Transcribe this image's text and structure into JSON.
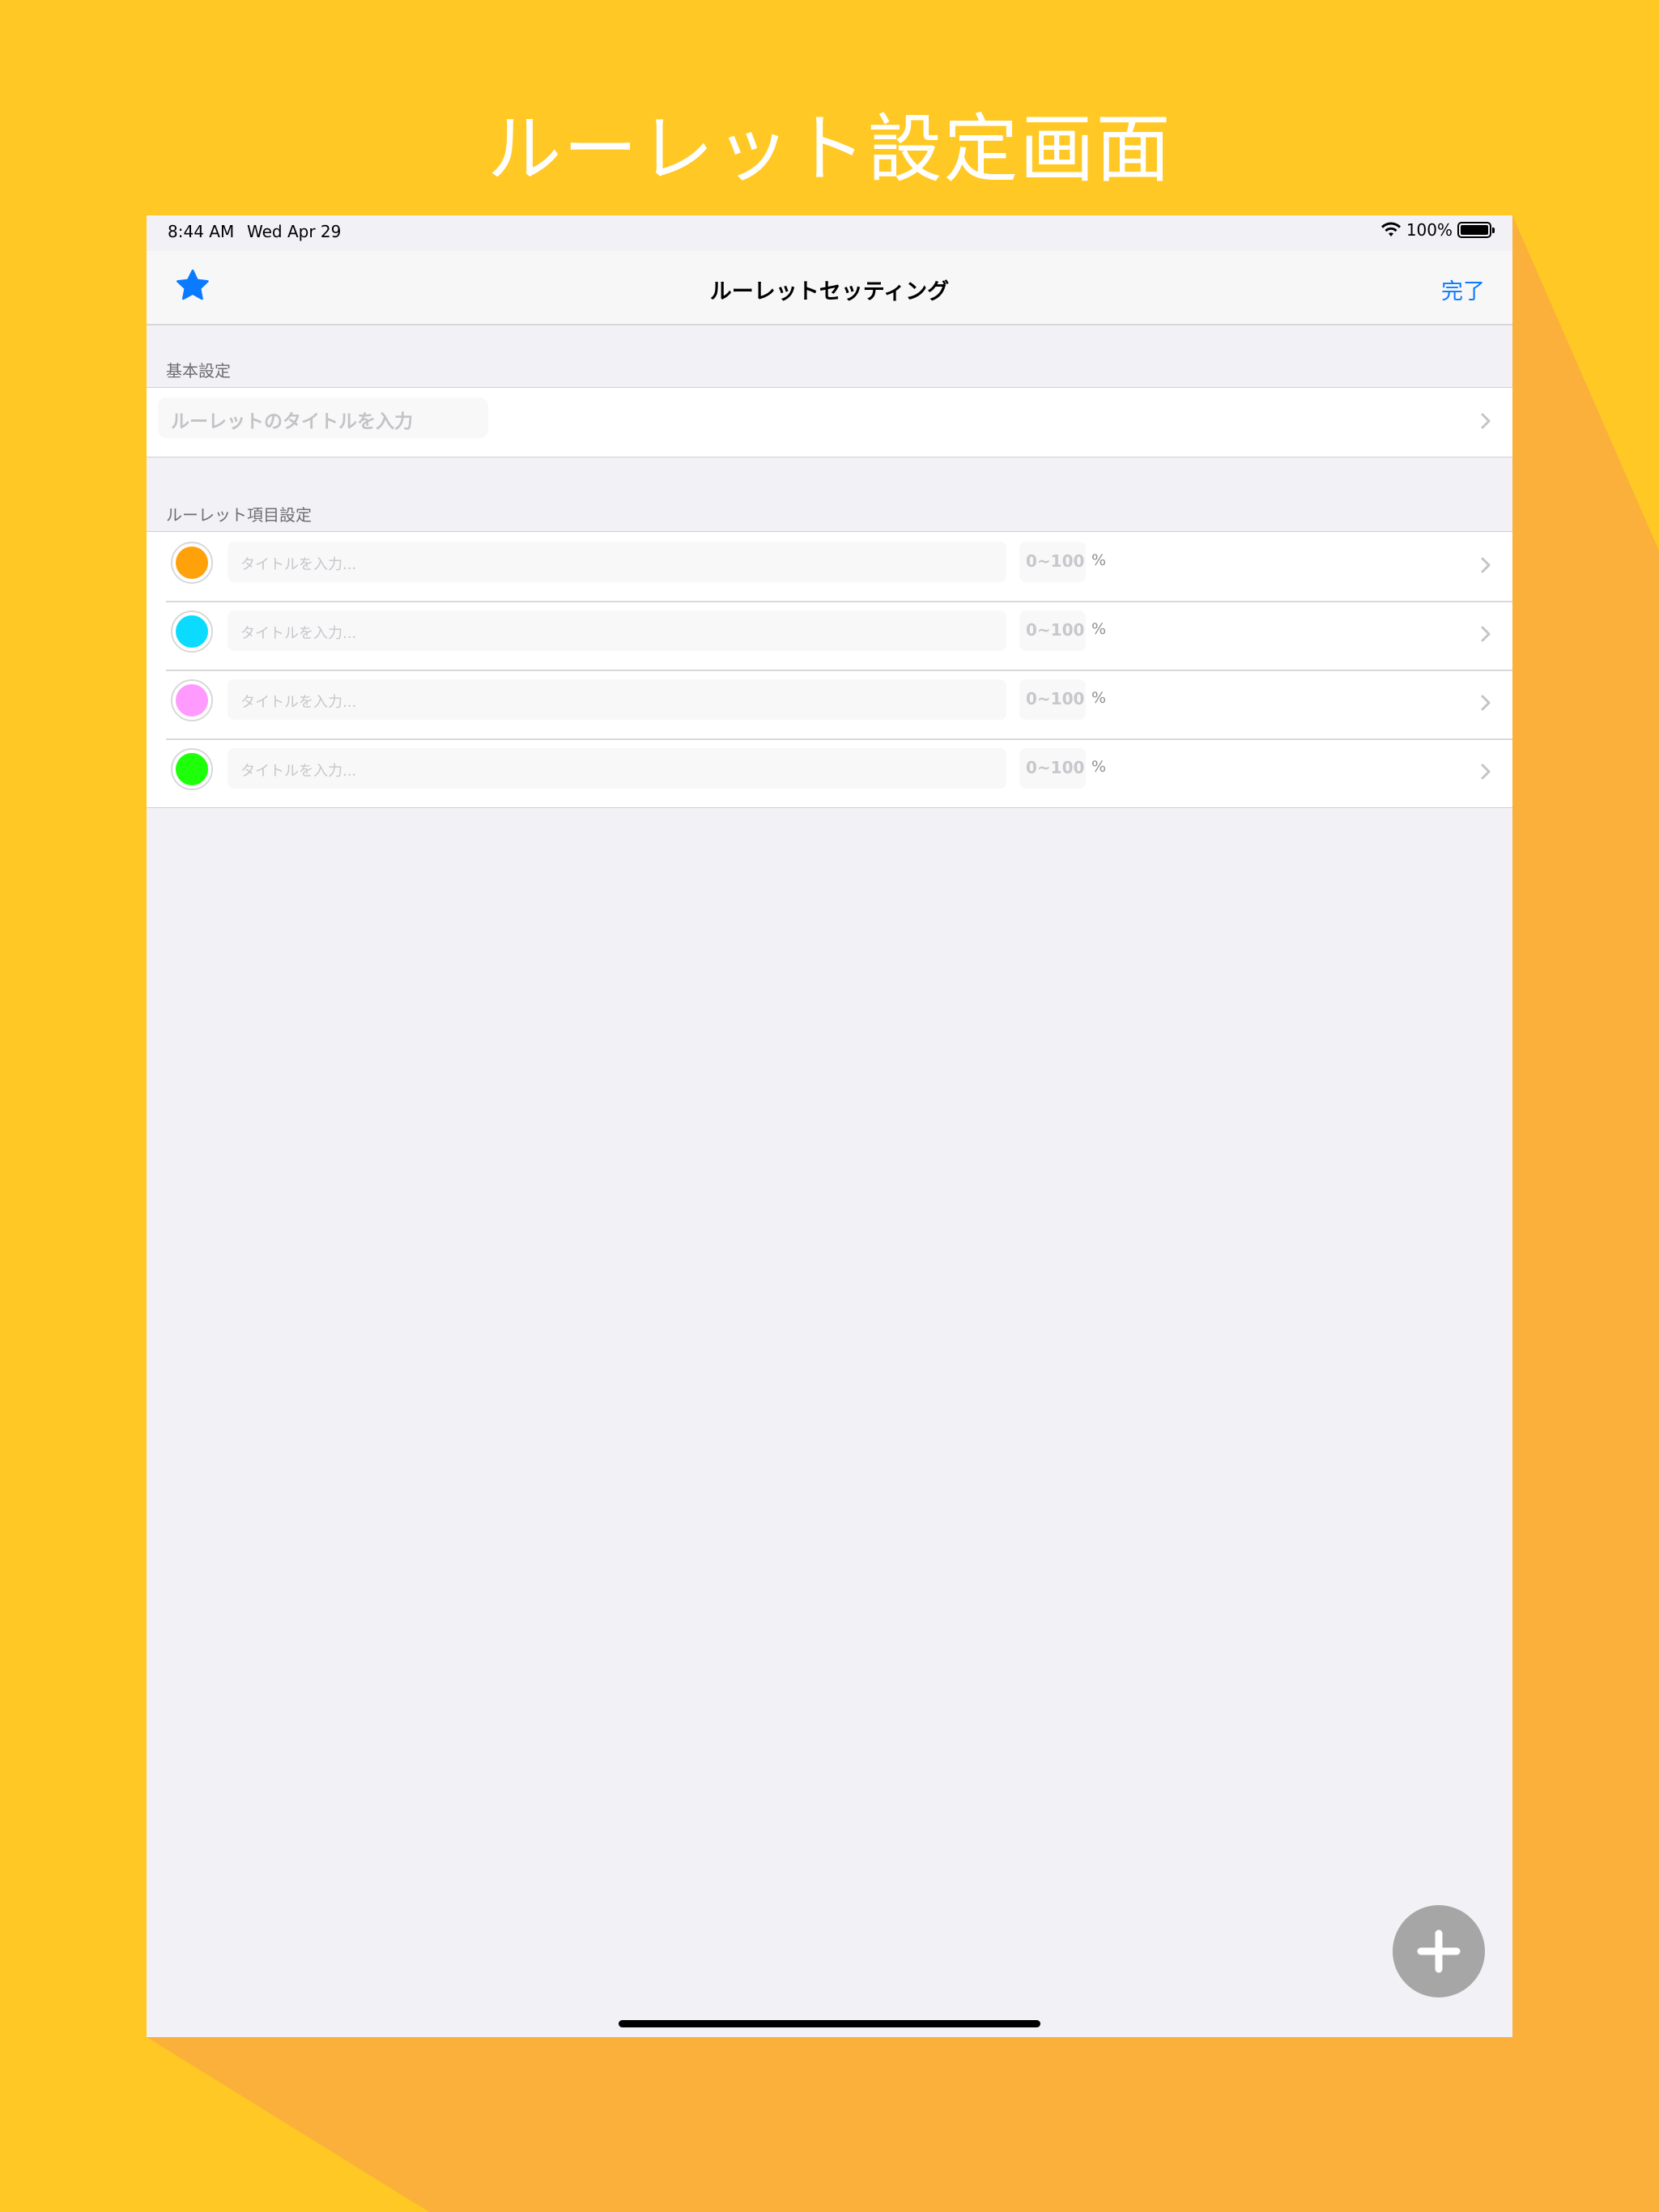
{
  "promo": {
    "title": "ルーレット設定画面",
    "background_color": "#FFC824",
    "shadow_color": "#FBB03B"
  },
  "status_bar": {
    "time": "8:44 AM",
    "date": "Wed Apr 29",
    "battery": "100%",
    "icons": [
      "wifi-icon",
      "battery-icon"
    ]
  },
  "navbar": {
    "left_icon": "star-icon",
    "title": "ルーレットセッティング",
    "done_label": "完了",
    "accent_color": "#0A7AFF"
  },
  "basic_section": {
    "header": "基本設定",
    "title_placeholder": "ルーレットのタイトルを入力"
  },
  "items_section": {
    "header": "ルーレット項目設定",
    "items": [
      {
        "color": "#FFA10A",
        "title_placeholder": "タイトルを入力...",
        "percent_placeholder": "0~100",
        "percent_sign": "%"
      },
      {
        "color": "#0ADBFF",
        "title_placeholder": "タイトルを入力...",
        "percent_placeholder": "0~100",
        "percent_sign": "%"
      },
      {
        "color": "#FF9BFF",
        "title_placeholder": "タイトルを入力...",
        "percent_placeholder": "0~100",
        "percent_sign": "%"
      },
      {
        "color": "#1EFF0A",
        "title_placeholder": "タイトルを入力...",
        "percent_placeholder": "0~100",
        "percent_sign": "%"
      }
    ]
  },
  "fab": {
    "icon": "plus-icon",
    "color": "#A6A6A6"
  }
}
